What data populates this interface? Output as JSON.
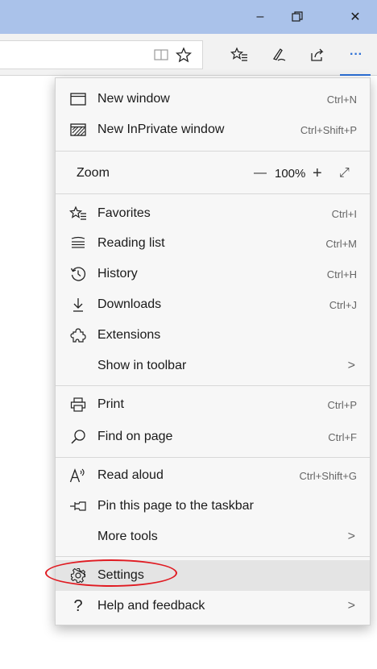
{
  "window": {
    "minimize_glyph": "–",
    "restore_glyph": "❐",
    "close_glyph": "✕"
  },
  "toolbar": {
    "icons": [
      "reading-view-icon",
      "favorite-star-icon",
      "favorites-hub-icon",
      "web-note-icon",
      "share-icon",
      "more-icon"
    ],
    "more_glyph": "···"
  },
  "menu": {
    "new_window": {
      "label": "New window",
      "shortcut": "Ctrl+N",
      "icon": "window-icon"
    },
    "new_inprivate": {
      "label": "New InPrivate window",
      "shortcut": "Ctrl+Shift+P",
      "icon": "inprivate-icon"
    },
    "zoom": {
      "label": "Zoom",
      "minus": "—",
      "value": "100%",
      "plus": "+",
      "fullscreen": "⤢"
    },
    "favorites": {
      "label": "Favorites",
      "shortcut": "Ctrl+I",
      "icon": "favorites-icon"
    },
    "reading_list": {
      "label": "Reading list",
      "shortcut": "Ctrl+M",
      "icon": "reading-list-icon"
    },
    "history": {
      "label": "History",
      "shortcut": "Ctrl+H",
      "icon": "history-icon"
    },
    "downloads": {
      "label": "Downloads",
      "shortcut": "Ctrl+J",
      "icon": "download-icon"
    },
    "extensions": {
      "label": "Extensions",
      "icon": "extensions-icon"
    },
    "show_in_toolbar": {
      "label": "Show in toolbar",
      "chevron": ">"
    },
    "print": {
      "label": "Print",
      "shortcut": "Ctrl+P",
      "icon": "print-icon"
    },
    "find_on_page": {
      "label": "Find on page",
      "shortcut": "Ctrl+F",
      "icon": "search-icon"
    },
    "read_aloud": {
      "label": "Read aloud",
      "shortcut": "Ctrl+Shift+G",
      "icon": "read-aloud-icon"
    },
    "pin_taskbar": {
      "label": "Pin this page to the taskbar",
      "icon": "pin-icon"
    },
    "more_tools": {
      "label": "More tools",
      "chevron": ">"
    },
    "settings": {
      "label": "Settings",
      "icon": "gear-icon"
    },
    "help": {
      "label": "Help and feedback",
      "icon_glyph": "?",
      "chevron": ">"
    }
  },
  "colors": {
    "titlebar": "#aac2ea",
    "menu_bg": "#f7f7f7",
    "highlight": "#e4e4e4",
    "annotation_ring": "#e01b22",
    "accent_underline": "#2b6fd6"
  }
}
